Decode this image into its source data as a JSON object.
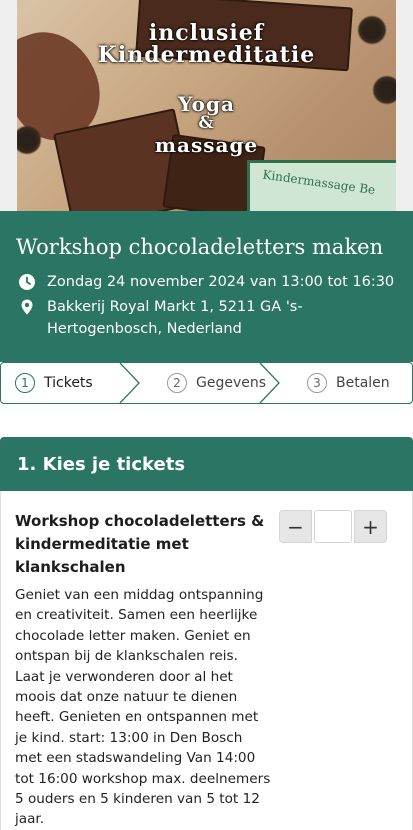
{
  "hero": {
    "line1": "inclusief",
    "line2": "Kindermeditatie",
    "line3": "Yoga",
    "line4": "&",
    "line5": "massage",
    "card_text": "Kindermassage Be"
  },
  "event": {
    "title": "Workshop chocoladeletters maken",
    "datetime": "Zondag 24 november 2024 van 13:00 tot 16:30",
    "location": "Bakkerij Royal Markt 1, 5211 GA 's-Hertogenbosch, Nederland"
  },
  "steps": [
    {
      "number": "1",
      "label": "Tickets"
    },
    {
      "number": "2",
      "label": "Gegevens"
    },
    {
      "number": "3",
      "label": "Betalen"
    }
  ],
  "section": {
    "heading": "1. Kies je tickets"
  },
  "ticket": {
    "title": "Workshop chocoladeletters & kindermeditatie met klankschalen",
    "description": "Geniet van een middag ontspanning en creativiteit. Samen een heerlijke chocolade letter maken. Geniet en ontspan bij de klankschalen reis. Laat je verwonderen door al het moois dat onze natuur te dienen heeft. Genieten en ontspannen met je kind. start: 13:00 in Den Bosch met een stadswandeling Van 14:00 tot 16:00 workshop max. deelnemers 5 ouders en 5 kinderen van 5 tot 12 jaar.",
    "minus_label": "−",
    "plus_label": "+",
    "quantity": ""
  },
  "colors": {
    "brand": "#2a7563"
  }
}
